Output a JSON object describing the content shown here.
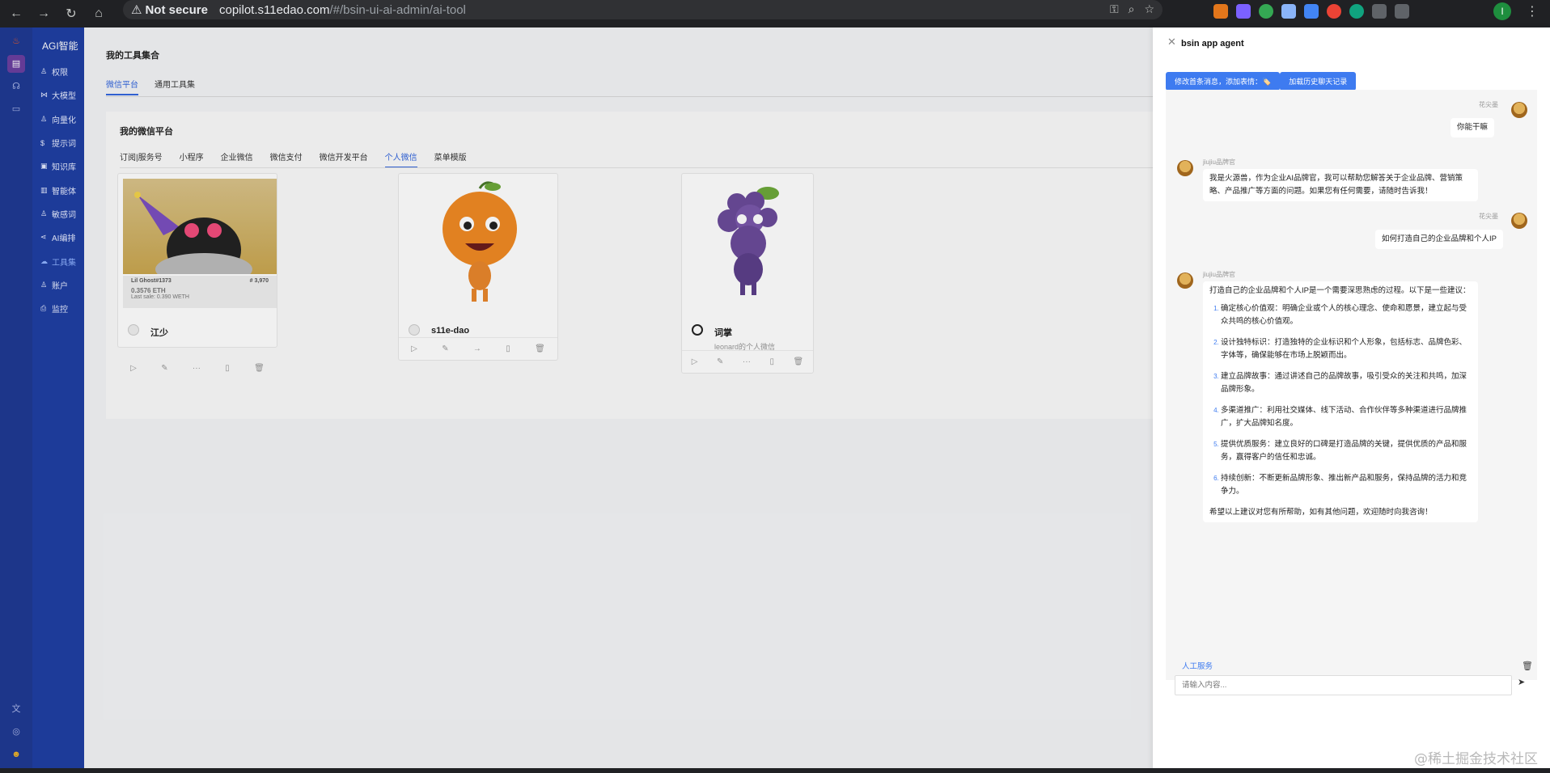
{
  "browser": {
    "warning": "Not secure",
    "url_host": "copilot.s11edao.com",
    "url_path": "/#/bsin-ui-ai-admin/ai-tool",
    "profile_initial": "I"
  },
  "sidebar": {
    "brand": "AGI智能",
    "items": [
      {
        "label": "权限"
      },
      {
        "label": "大模型"
      },
      {
        "label": "向量化"
      },
      {
        "label": "提示词"
      },
      {
        "label": "知识库"
      },
      {
        "label": "智能体"
      },
      {
        "label": "敏感词"
      },
      {
        "label": "AI编排"
      },
      {
        "label": "工具集"
      },
      {
        "label": "账户"
      },
      {
        "label": "监控"
      }
    ]
  },
  "main": {
    "title": "我的工具集合",
    "tabs": [
      "微信平台",
      "通用工具集"
    ],
    "section_title": "我的微信平台",
    "subtabs": [
      "订阅|服务号",
      "小程序",
      "企业微信",
      "微信支付",
      "微信开发平台",
      "个人微信",
      "菜单模版"
    ],
    "cards": [
      {
        "name": "江少",
        "desc": "",
        "nft_title": "Lil Ghost#1373",
        "nft_id": "# 3,970",
        "nft_price": "0.3576 ETH",
        "nft_last": "Last sale: 0.390 WETH"
      },
      {
        "name": "s11e-dao",
        "desc": ""
      },
      {
        "name": "词掌",
        "desc": "leonard的个人微信"
      }
    ]
  },
  "drawer": {
    "title": "bsin app agent",
    "btn_edit": "修改首条消息，添加表情：🏷️",
    "btn_history": "加载历史聊天记录",
    "user_name": "花尖墨",
    "bot_name": "jiujiu品牌官",
    "messages": {
      "u1": "你能干嘛",
      "b1": "我是火源兽，作为企业AI品牌官，我可以帮助您解答关于企业品牌、营销策略、产品推广等方面的问题。如果您有任何需要，请随时告诉我！",
      "u2": "如何打造自己的企业品牌和个人IP",
      "b2_intro": "打造自己的企业品牌和个人IP是一个需要深思熟虑的过程。以下是一些建议：",
      "b2_items": [
        "确定核心价值观：明确企业或个人的核心理念、使命和愿景，建立起与受众共鸣的核心价值观。",
        "设计独特标识：打造独特的企业标识和个人形象，包括标志、品牌色彩、字体等，确保能够在市场上脱颖而出。",
        "建立品牌故事：通过讲述自己的品牌故事，吸引受众的关注和共鸣，加深品牌形象。",
        "多渠道推广：利用社交媒体、线下活动、合作伙伴等多种渠道进行品牌推广，扩大品牌知名度。",
        "提供优质服务：建立良好的口碑是打造品牌的关键，提供优质的产品和服务，赢得客户的信任和忠诚。",
        "持续创新：不断更新品牌形象、推出新产品和服务，保持品牌的活力和竞争力。"
      ],
      "b2_outro": "希望以上建议对您有所帮助，如有其他问题，欢迎随时向我咨询！"
    },
    "human_service": "人工服务",
    "input_placeholder": "请输入内容...",
    "watermark": "@稀土掘金技术社区"
  },
  "colors": {
    "accent": "#3e7bf0",
    "rail": "#1f3a93",
    "sidebar": "#1f3fa3"
  }
}
